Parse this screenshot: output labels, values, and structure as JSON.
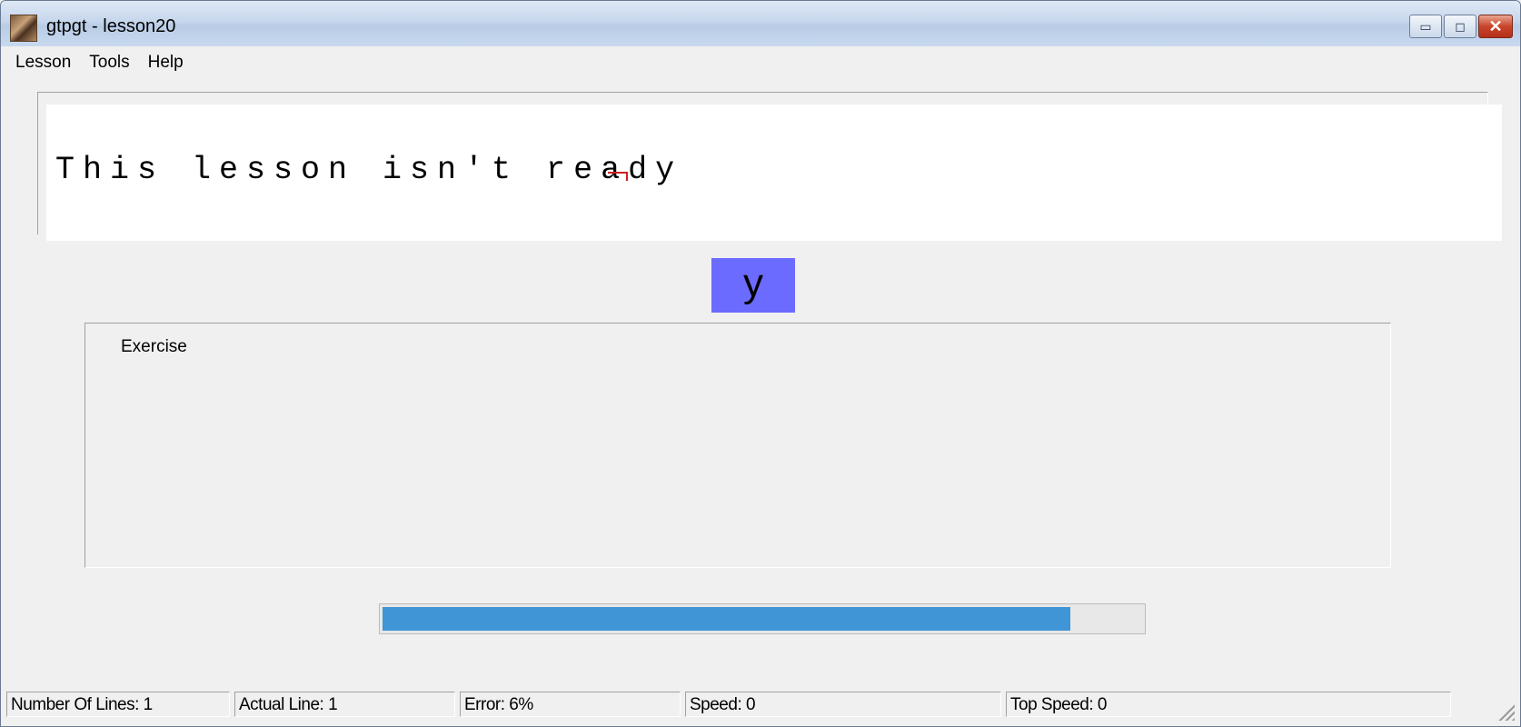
{
  "window": {
    "title": "gtpgt - lesson20"
  },
  "titlebar": {
    "minimize": "▭",
    "maximize": "◻",
    "close": "✕"
  },
  "menu": {
    "items": [
      "Lesson",
      "Tools",
      "Help"
    ]
  },
  "lesson": {
    "text": "This lesson isn't ready"
  },
  "current_key": "y",
  "exercise": {
    "label": "Exercise"
  },
  "progress": {
    "fraction": 0.905,
    "color": "#3f95d6"
  },
  "status": {
    "lines": "Number Of Lines: 1",
    "actual_line": "Actual Line: 1",
    "error": "Error: 6%",
    "speed": "Speed: 0",
    "top_speed": "Top Speed: 0"
  },
  "colors": {
    "key_bg": "#6b6bff",
    "cursor": "#d02020"
  }
}
